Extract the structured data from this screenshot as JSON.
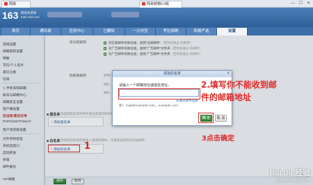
{
  "browser": {
    "tabs": [
      {
        "label": "网易",
        "active": false
      },
      {
        "label": "网易邮箱6.0版",
        "active": true
      }
    ],
    "controls": "— ☐ ✕"
  },
  "header": {
    "logo": "163",
    "logo_sub_line1": "网易免费邮",
    "logo_sub_line2": "mail.163.com"
  },
  "nav": {
    "tabs": [
      {
        "label": "首页",
        "active": false
      },
      {
        "label": "通讯录",
        "active": false
      },
      {
        "label": "应用中心",
        "active": false
      },
      {
        "label": "已删除",
        "active": false
      },
      {
        "label": "一元夺宝",
        "active": false
      },
      {
        "label": "考拉海购",
        "active": false
      },
      {
        "label": "网易严选",
        "active": false
      },
      {
        "label": "设置",
        "active": true
      }
    ]
  },
  "sidebar": {
    "items": [
      {
        "label": "常规设置",
        "selected": false
      },
      {
        "label": "邮箱密码设置",
        "selected": false
      },
      {
        "label": "换肤",
        "selected": false
      },
      {
        "label": "写信/个人名片",
        "selected": false
      },
      {
        "label": "来信分类",
        "selected": false
      },
      {
        "label": "信纸",
        "selected": false
      },
      {
        "label": "◇ 手机号码邮箱",
        "selected": false
      },
      {
        "label": "帐号与邮箱中心",
        "selected": false
      },
      {
        "label": "邮箱安全设置",
        "selected": false
      },
      {
        "label": "客户端设置",
        "selected": false
      },
      {
        "label": "反垃圾/黑白名单",
        "selected": true
      },
      {
        "label": "POP3/SMTP/IMAP",
        "selected": false
      },
      {
        "label": "客户测试版设置",
        "selected": false
      },
      {
        "label": "文件夹和标签",
        "selected": false
      },
      {
        "label": "多标签窗口",
        "selected": false
      },
      {
        "label": "自动转发",
        "selected": false
      },
      {
        "label": "杀毒",
        "selected": false
      },
      {
        "label": "邮件备份",
        "selected": false
      },
      {
        "label": "VIP邮箱",
        "selected": false
      }
    ]
  },
  "main": {
    "option_labels": [
      "反垃圾规则",
      "防病毒规则"
    ],
    "options": [
      {
        "text": "对已发邮件有防垃圾，放到“垃圾邮件”",
        "hint": "（若你有收过 的邮件）"
      },
      {
        "text": "对广告邮件有防垃圾，放到“广告邮件”文件夹",
        "hint": "（若你有收过 的邮件）"
      },
      {
        "text": "对广告邮件有防垃圾，放到“广告邮件”文件夹",
        "hint": "（若你有收过 的邮件）"
      }
    ],
    "blacklist": {
      "title": "黑名单",
      "desc": "添加到黑名单的邮件地址发来的邮件将直接被拒收",
      "add_label": "+ 添加黑名单"
    },
    "whitelist": {
      "title": "白名单",
      "desc": "添加到白名单的联系人发来的邮件，可避免被误判为垃圾邮件",
      "add_label": "+ 添加白名单"
    },
    "save_label": "保存",
    "cancel_label": "取消"
  },
  "modal": {
    "title": "添加白名单",
    "close": "×",
    "prompt": "请输入一个邮箱地址或域名地址。",
    "input_value": "",
    "input_placeholder": "",
    "contact_link": "从通讯录中选择",
    "example": "如：mail@example.com，example.com",
    "ok_label": "确 定",
    "cancel_label": "取 消"
  },
  "annotations": {
    "step1": "1",
    "step2_line1": "2.填写你不能收到邮",
    "step2_line2": "件的邮箱地址",
    "step3": "3点击确定",
    "color": "#e02a2a"
  },
  "watermark": {
    "line1": "Bai du 经验",
    "line2": "jingyan.baidu.com"
  }
}
